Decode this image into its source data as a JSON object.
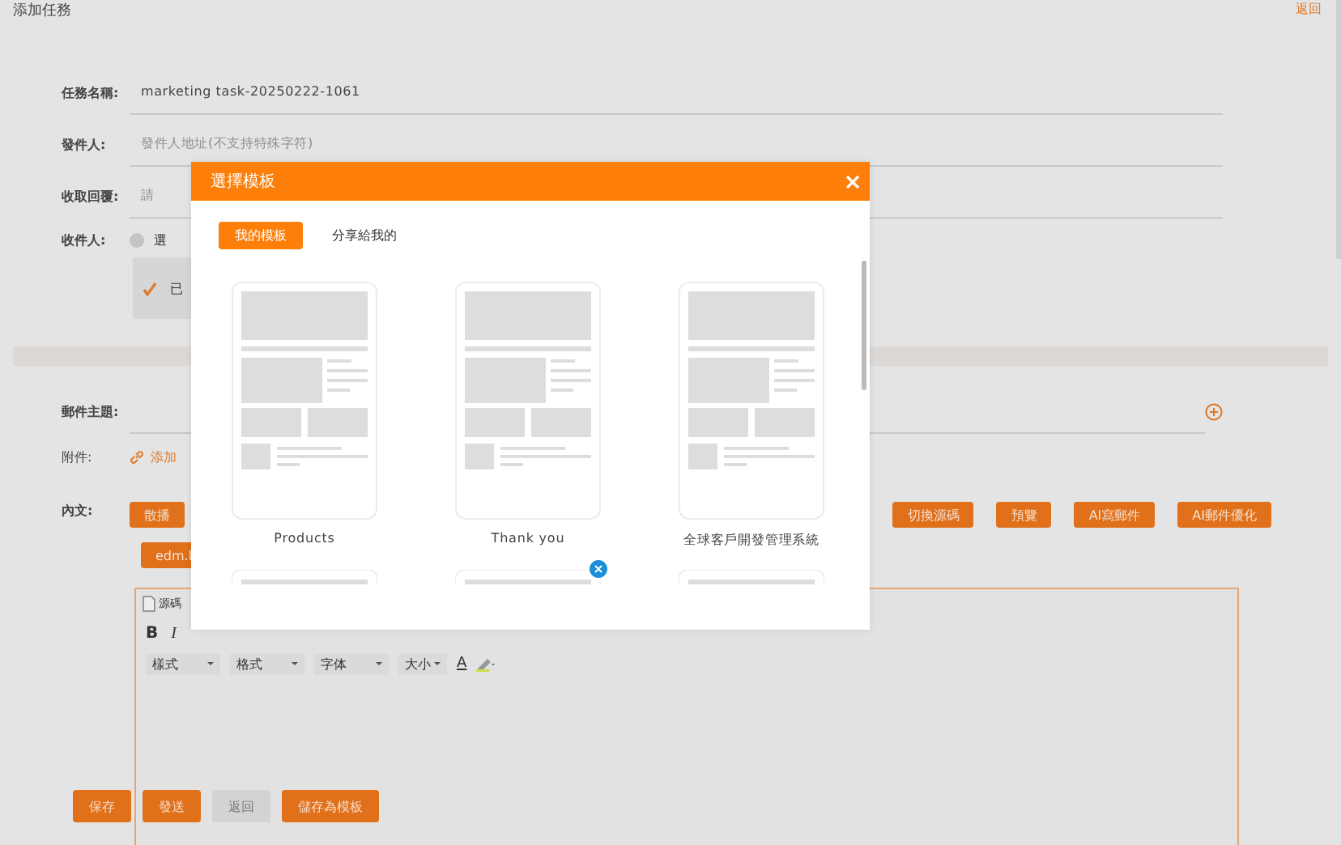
{
  "page": {
    "title": "添加任務",
    "back_link": "返回"
  },
  "fields": [
    {
      "label": "任務名稱:",
      "value": "marketing task-20250222-1061"
    },
    {
      "label": "發件人:",
      "placeholder": "發件人地址(不支持特殊字符)"
    },
    {
      "label": "收取回覆:",
      "placeholder": "請"
    }
  ],
  "recipients": {
    "label": "收件人:",
    "option": "選",
    "option_selected": false,
    "chosen": "已"
  },
  "subject": {
    "label": "郵件主題:"
  },
  "attachment": {
    "label": "附件:",
    "link": "添加"
  },
  "content": {
    "label": "內文:",
    "buttons": [
      {
        "label": "散播"
      },
      {
        "label": "切換源碼"
      },
      {
        "label": "預覽"
      },
      {
        "label": "AI寫郵件"
      },
      {
        "label": "AI郵件優化"
      }
    ],
    "second_row": [
      {
        "label": "edm.l"
      }
    ]
  },
  "editor": {
    "source": "源碼",
    "bold": "B",
    "italic": "I",
    "dropdowns": [
      "樣式",
      "格式",
      "字体",
      "大小"
    ],
    "font_color": "A"
  },
  "actions": [
    {
      "label": "保存",
      "disabled": false
    },
    {
      "label": "發送",
      "disabled": false
    },
    {
      "label": "返回",
      "disabled": true
    },
    {
      "label": "儲存為模板",
      "disabled": false
    }
  ],
  "modal": {
    "title": "選擇模板",
    "tabs": [
      {
        "label": "我的模板",
        "selected": true
      },
      {
        "label": "分享給我的",
        "selected": false
      }
    ],
    "templates": [
      {
        "name": "Products",
        "removable": false
      },
      {
        "name": "Thank you",
        "removable": false
      },
      {
        "name": "全球客戶開發管理系統",
        "removable": false
      },
      {
        "removable": false
      },
      {
        "removable": true
      },
      {
        "removable": false
      }
    ]
  }
}
